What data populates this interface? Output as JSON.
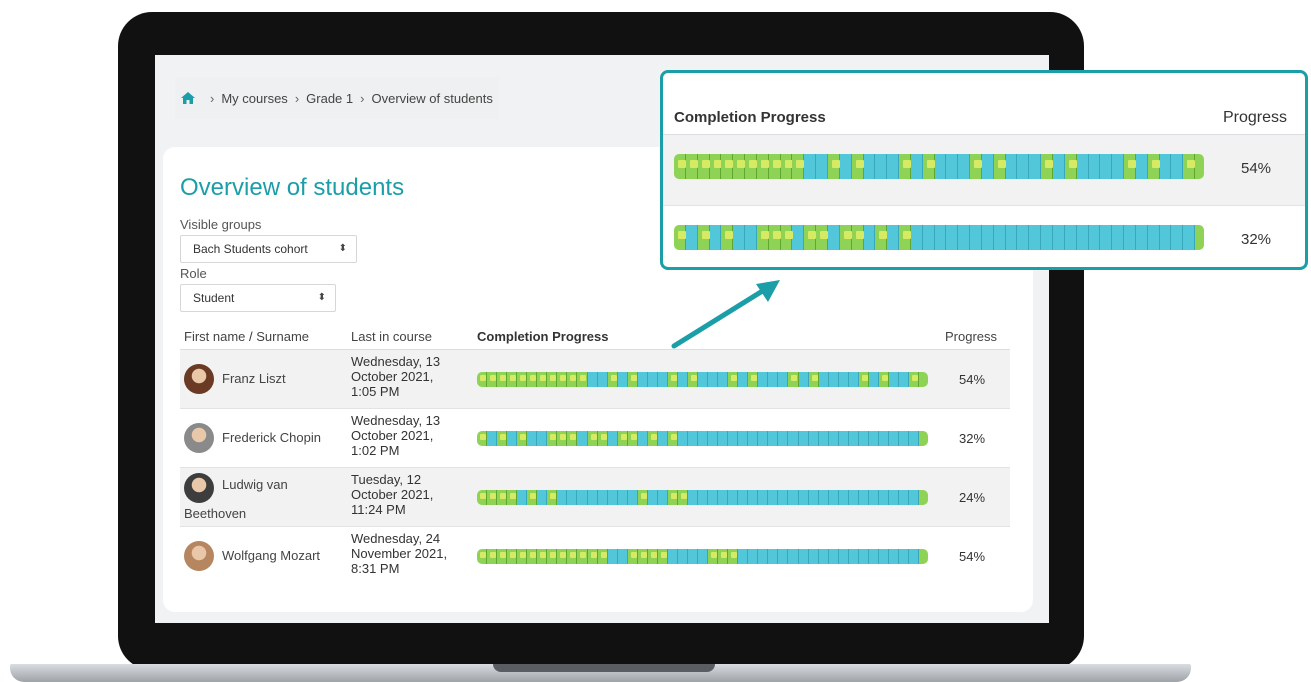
{
  "breadcrumb": [
    "My courses",
    "Grade 1",
    "Overview of students"
  ],
  "page_title": "Overview of students",
  "filters": {
    "groups_label": "Visible groups",
    "groups_value": "Bach Students cohort",
    "role_label": "Role",
    "role_value": "Student"
  },
  "table": {
    "headers": {
      "first_name": "First name",
      "separator": " / ",
      "surname": "Surname",
      "last_in_course": "Last in course",
      "completion": "Completion Progress",
      "progress": "Progress"
    },
    "rows": [
      {
        "name_line1": "Franz Liszt",
        "name_line2": "",
        "last_in": "Wednesday, 13 October 2021, 1:05 PM",
        "progress": "54%",
        "segments": "11111111111001010001010001010001010000101001",
        "avatar_color": "#6b3a24"
      },
      {
        "name_line1": "Frederick Chopin",
        "name_line2": "",
        "last_in": "Wednesday, 13 October 2021, 1:02 PM",
        "progress": "32%",
        "segments": "10101001110110110101000000000000000000000000",
        "avatar_color": "#8a8a8a"
      },
      {
        "name_line1": "Ludwig van",
        "name_line2": "Beethoven",
        "last_in": "Tuesday, 12 October 2021, 11:24 PM",
        "progress": "24%",
        "segments": "11110101000000001001100000000000000000000000",
        "avatar_color": "#3d3d3d"
      },
      {
        "name_line1": "Wolfgang Mozart",
        "name_line2": "",
        "last_in": "Wednesday, 24 November 2021, 8:31 PM",
        "progress": "54%",
        "segments": "11111111111110011110000111000000000000000000",
        "avatar_color": "#b5865f"
      }
    ]
  },
  "callout": {
    "completion_label": "Completion Progress",
    "progress_label": "Progress",
    "rows": [
      {
        "progress": "54%",
        "segments": "11111111111001010001010001010001010000101001"
      },
      {
        "progress": "32%",
        "segments": "10101001110110110101000000000000000000000000"
      }
    ]
  },
  "colors": {
    "accent": "#1c9ea8",
    "complete": "#8ed356",
    "incomplete": "#52c7d9"
  },
  "icons": {
    "home": "home-icon",
    "select": "updown-caret-icon"
  }
}
